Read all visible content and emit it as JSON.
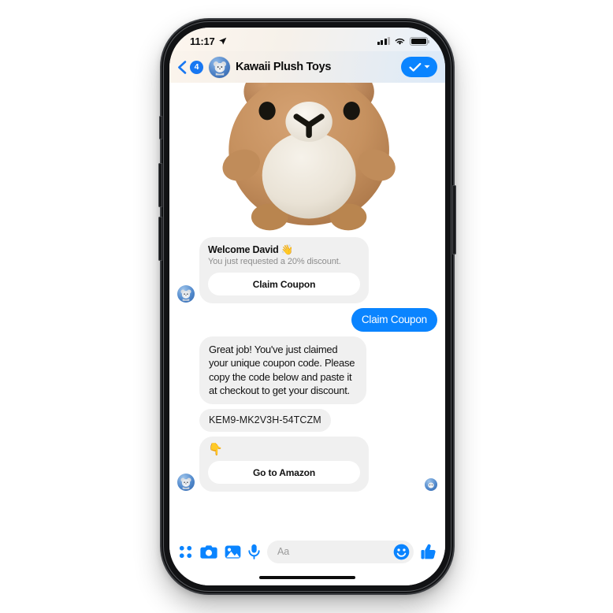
{
  "status_bar": {
    "time": "11:17",
    "location_icon": "location-arrow-icon",
    "signal_icon": "cellular-signal-icon",
    "wifi_icon": "wifi-icon",
    "battery_icon": "battery-icon"
  },
  "header": {
    "back_icon": "chevron-left-icon",
    "unread_badge": "4",
    "avatar": "page-avatar-bear",
    "title": "Kawaii Plush Toys",
    "verified_icon": "check-icon",
    "verified_chevron_icon": "chevron-down-icon"
  },
  "hero": {
    "name": "plush-toy-photo",
    "alt": "Brown teddy bear plush toy"
  },
  "messages": [
    {
      "type": "card",
      "from": "bot",
      "title": "Welcome David 👋",
      "subtitle": "You just requested a 20% discount.",
      "button": "Claim Coupon"
    },
    {
      "type": "outgoing",
      "text": "Claim Coupon"
    },
    {
      "type": "incoming",
      "text": "Great job! You've just claimed your unique coupon code. Please copy the code below and paste it at checkout to get your discount."
    },
    {
      "type": "code",
      "text": "KEM9-MK2V3H-54TCZM"
    },
    {
      "type": "card",
      "from": "bot",
      "emoji": "👇",
      "button": "Go to Amazon"
    }
  ],
  "composer": {
    "apps_icon": "grid-dots-icon",
    "camera_icon": "camera-icon",
    "gallery_icon": "photo-icon",
    "mic_icon": "microphone-icon",
    "input_placeholder": "Aa",
    "emoji_icon": "smiley-icon",
    "like_icon": "thumbs-up-icon"
  },
  "colors": {
    "accent_blue": "#0a84ff",
    "badge_blue": "#1877f2",
    "bubble_grey": "#f0f0f0",
    "text_dark": "#111111",
    "text_muted": "#8d8d8d"
  }
}
